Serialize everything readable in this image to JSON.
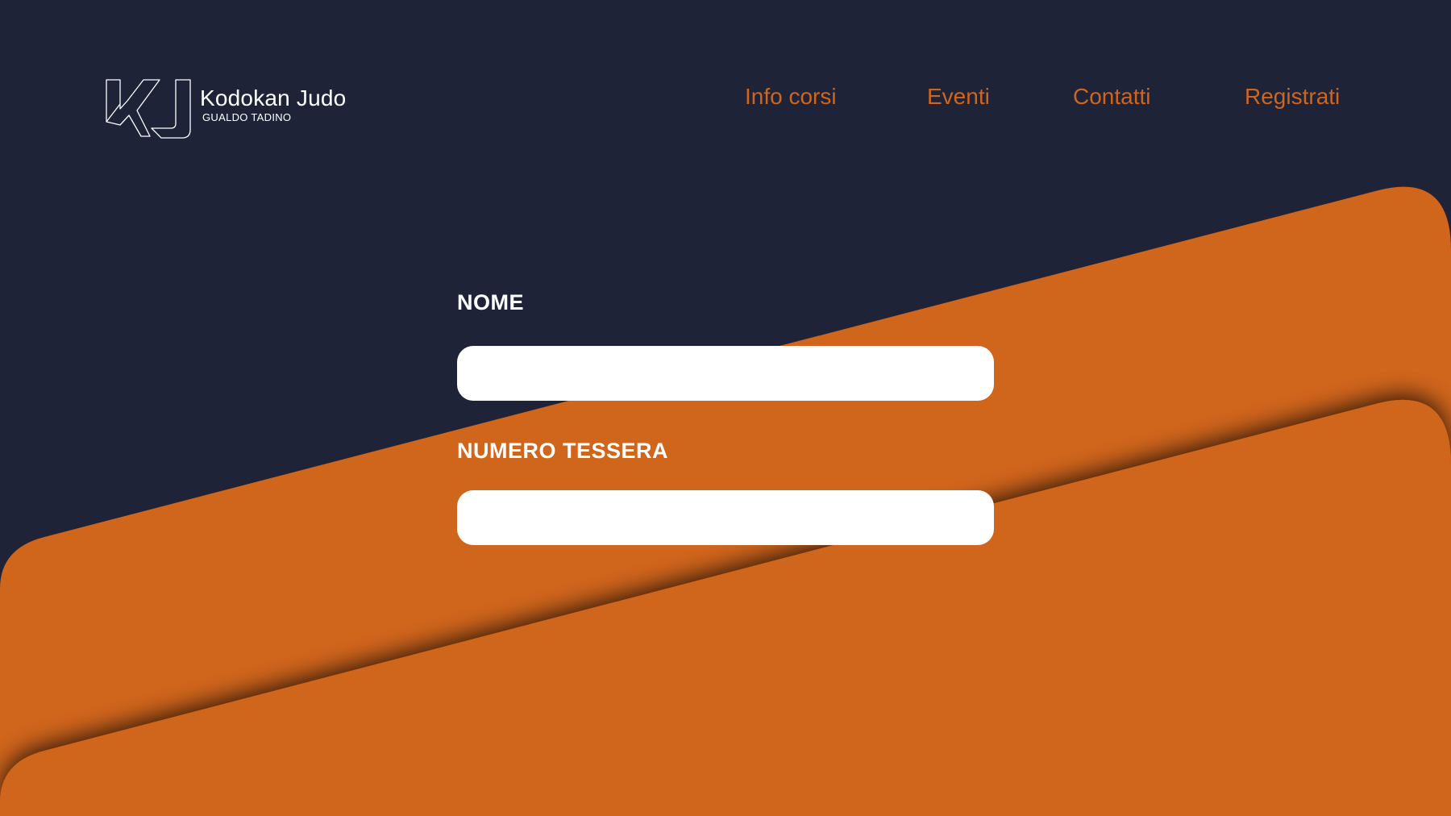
{
  "brand": {
    "title": "Kodokan Judo",
    "subtitle": "GUALDO TADINO",
    "logo_icon": "kj-monogram-icon"
  },
  "nav": {
    "items": [
      {
        "label": "Info corsi"
      },
      {
        "label": "Eventi"
      },
      {
        "label": "Contatti"
      },
      {
        "label": "Registrati"
      }
    ]
  },
  "form": {
    "fields": [
      {
        "label": "NOME",
        "value": "",
        "placeholder": ""
      },
      {
        "label": "NUMERO TESSERA",
        "value": "",
        "placeholder": ""
      }
    ]
  },
  "colors": {
    "background": "#1f2337",
    "accent": "#d0651c",
    "text_light": "#ffffff",
    "input_bg": "#ffffff"
  }
}
